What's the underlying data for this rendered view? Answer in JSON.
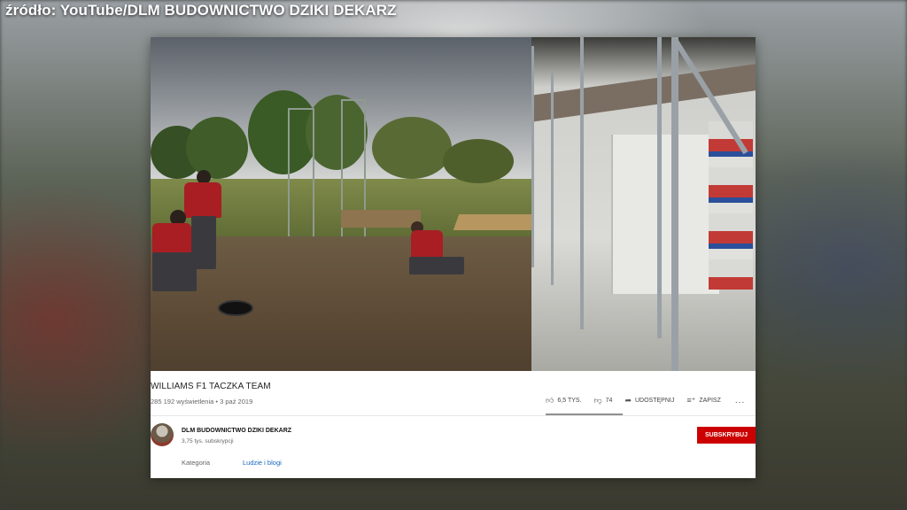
{
  "source_caption": "źródło: YouTube/DLM BUDOWNICTWO DZIKI DEKARZ",
  "video": {
    "title": "WILLIAMS F1 TACZKA TEAM",
    "views": "285 192 wyświetlenia",
    "separator": "•",
    "date": "3 paź 2019"
  },
  "actions": {
    "likes": "6,5 TYS.",
    "dislikes": "74",
    "share": "UDOSTĘPNIJ",
    "save": "ZAPISZ",
    "more": "..."
  },
  "channel": {
    "name": "DLM BUDOWNICTWO DZIKI DEKARZ",
    "subscribers": "3,75 tys. subskrypcji",
    "subscribe_label": "SUBSKRYBUJ"
  },
  "category": {
    "label": "Kategoria",
    "value": "Ludzie i blogi"
  },
  "colors": {
    "subscribe": "#cc0000",
    "link": "#1565c0"
  },
  "icons": [
    "thumb-up-icon",
    "thumb-down-icon",
    "share-icon",
    "playlist-add-icon",
    "more-icon"
  ]
}
